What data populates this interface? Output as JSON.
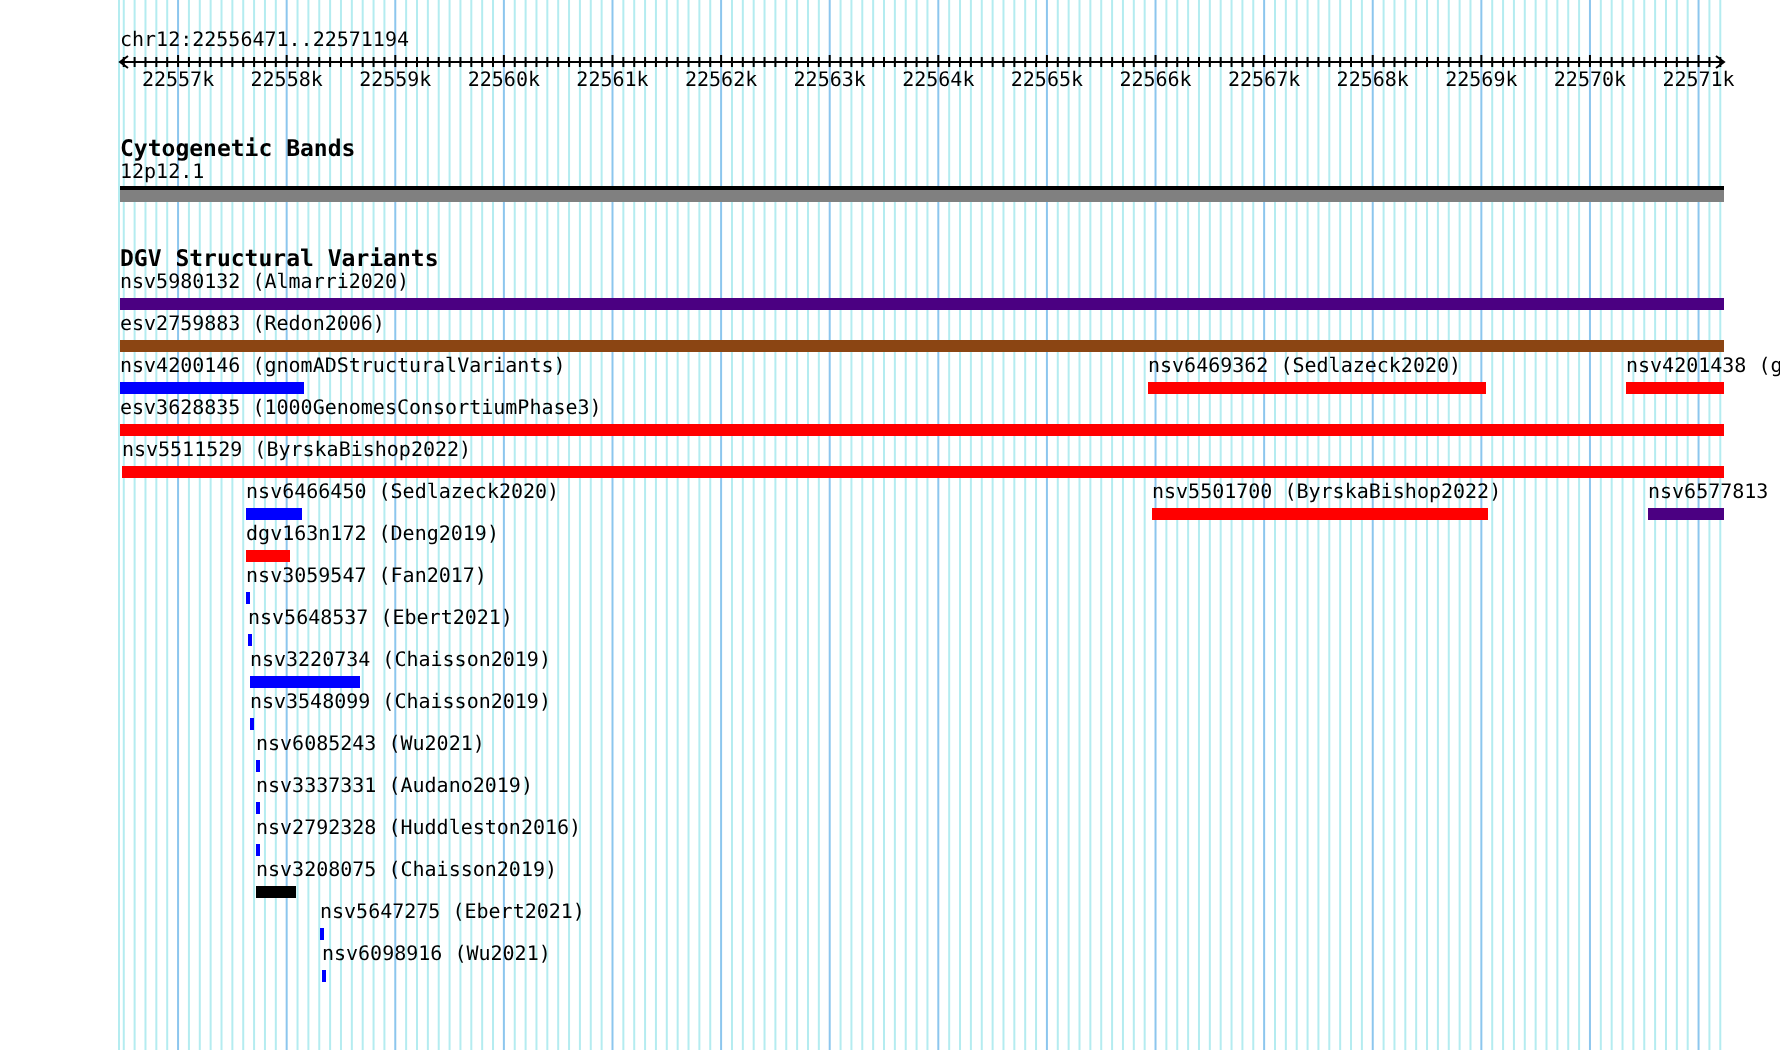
{
  "view": {
    "label": "chr12:22556471..22571194"
  },
  "ruler": {
    "ticks": [
      "22557k",
      "22558k",
      "22559k",
      "22560k",
      "22561k",
      "22562k",
      "22563k",
      "22564k",
      "22565k",
      "22566k",
      "22567k",
      "22568k",
      "22569k",
      "22570k",
      "22571k"
    ]
  },
  "tracks": [
    {
      "kind": "bands",
      "title": "Cytogenetic Bands",
      "rows": [
        {
          "features": [
            {
              "label": "12p12.1",
              "color": "#808080"
            }
          ]
        }
      ]
    },
    {
      "kind": "variants",
      "title": "DGV Structural Variants",
      "rows": [
        {
          "features": [
            {
              "label": "nsv5980132 (Almarri2020)",
              "color": "#4b0082"
            }
          ]
        },
        {
          "features": [
            {
              "label": "esv2759883 (Redon2006)",
              "color": "#8b4513"
            }
          ]
        },
        {
          "features": [
            {
              "label": "nsv4200146 (gnomADStructuralVariants)",
              "color": "#0000ff"
            },
            {
              "label": "nsv6469362 (Sedlazeck2020)",
              "color": "#ff0000"
            },
            {
              "label": "nsv4201438 (g",
              "color": "#ff0000"
            }
          ]
        },
        {
          "features": [
            {
              "label": "esv3628835 (1000GenomesConsortiumPhase3)",
              "color": "#ff0000"
            }
          ]
        },
        {
          "features": [
            {
              "label": "nsv5511529 (ByrskaBishop2022)",
              "color": "#ff0000"
            }
          ]
        },
        {
          "features": [
            {
              "label": "nsv6466450 (Sedlazeck2020)",
              "color": "#0000ff"
            },
            {
              "label": "nsv5501700 (ByrskaBishop2022)",
              "color": "#ff0000"
            },
            {
              "label": "nsv6577813",
              "color": "#4b0082"
            }
          ]
        },
        {
          "features": [
            {
              "label": "dgv163n172 (Deng2019)",
              "color": "#ff0000"
            }
          ]
        },
        {
          "features": [
            {
              "label": "nsv3059547 (Fan2017)",
              "color": "#0000ff"
            }
          ]
        },
        {
          "features": [
            {
              "label": "nsv5648537 (Ebert2021)",
              "color": "#0000ff"
            }
          ]
        },
        {
          "features": [
            {
              "label": "nsv3220734 (Chaisson2019)",
              "color": "#0000ff"
            }
          ]
        },
        {
          "features": [
            {
              "label": "nsv3548099 (Chaisson2019)",
              "color": "#0000ff"
            }
          ]
        },
        {
          "features": [
            {
              "label": "nsv6085243 (Wu2021)",
              "color": "#0000ff"
            }
          ]
        },
        {
          "features": [
            {
              "label": "nsv3337331 (Audano2019)",
              "color": "#0000ff"
            }
          ]
        },
        {
          "features": [
            {
              "label": "nsv2792328 (Huddleston2016)",
              "color": "#0000ff"
            }
          ]
        },
        {
          "features": [
            {
              "label": "nsv3208075 (Chaisson2019)",
              "color": "#000000"
            }
          ]
        },
        {
          "features": [
            {
              "label": "nsv5647275 (Ebert2021)",
              "color": "#0000ff"
            }
          ]
        },
        {
          "features": [
            {
              "label": "nsv6098916 (Wu2021)",
              "color": "#0000ff"
            }
          ]
        }
      ]
    }
  ]
}
